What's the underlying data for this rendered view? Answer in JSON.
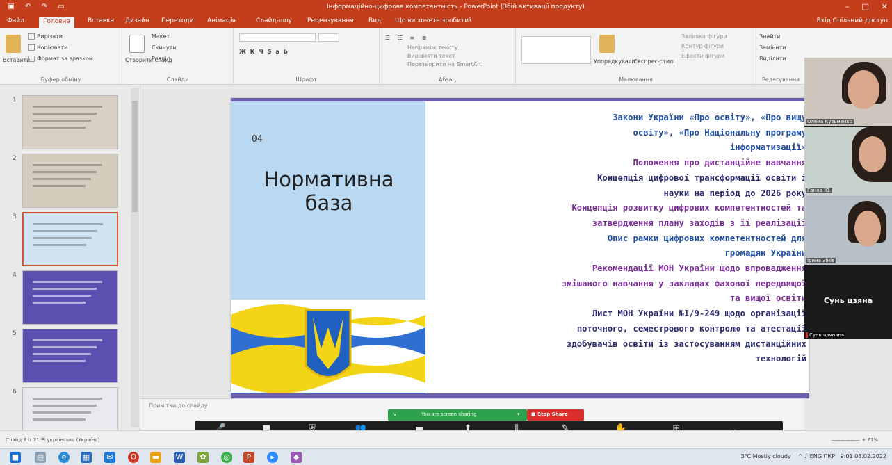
{
  "window": {
    "title": "Інформаційно-цифрова компетентність - PowerPoint (Збій активації продукту)",
    "controls": [
      "–",
      "□",
      "✕"
    ]
  },
  "tabs": [
    "Файл",
    "Головна",
    "Вставка",
    "Дизайн",
    "Переходи",
    "Анімація",
    "Слайд-шоу",
    "Рецензування",
    "Вид",
    "Що ви хочете зробити?"
  ],
  "active_tab_index": 1,
  "share_label": "Вхід  Спільний доступ",
  "ribbon": {
    "groups": [
      "Буфер обміну",
      "Слайди",
      "Шрифт",
      "Абзац",
      "Малювання",
      "Редагування"
    ],
    "clipboard": {
      "paste": "Вставити",
      "cut": "Вирізати",
      "copy": "Копіювати",
      "format": "Формат за зразком"
    },
    "slides": {
      "new_slide": "Створити слайд",
      "layout": "Макет",
      "reset": "Скинути",
      "section": "Розділ"
    },
    "paragraph": {
      "direction": "Напрямок тексту",
      "align": "Вирівняти текст",
      "smartart": "Перетворити на SmartArt"
    },
    "drawing": {
      "arrange": "Упорядкувати",
      "quick_styles": "Експрес-стилі",
      "fill": "Заливка фігури",
      "outline": "Контур фігури",
      "effects": "Ефекти фігури"
    },
    "editing": {
      "find": "Знайти",
      "replace": "Замінити",
      "select": "Виділити"
    }
  },
  "thumbnails": [
    {
      "num": "1",
      "bg": "#d9cfc2",
      "selected": false
    },
    {
      "num": "2",
      "bg": "#d6ccbd",
      "selected": false
    },
    {
      "num": "3",
      "bg": "#cfe3f3",
      "selected": true
    },
    {
      "num": "4",
      "bg": "#5b4fb0",
      "selected": false
    },
    {
      "num": "5",
      "bg": "#5b4fb0",
      "selected": false
    },
    {
      "num": "6",
      "bg": "#e9e9ef",
      "selected": false
    }
  ],
  "slide": {
    "number": "04",
    "heading_line1": "Нормативна",
    "heading_line2": "база",
    "lines": [
      {
        "text": "Закони України «Про освіту», «Про вищу",
        "color": "c-blue"
      },
      {
        "text": "освіту», «Про Національну програму",
        "color": "c-blue"
      },
      {
        "text": "інформатизації»",
        "color": "c-blue"
      },
      {
        "text": "Положення про дистанційне навчання",
        "color": "c-purple"
      },
      {
        "text": "Концепція цифрової трансформації освіти і",
        "color": "c-dark"
      },
      {
        "text": "науки на період до 2026 року",
        "color": "c-dark"
      },
      {
        "text": "Концепція розвитку цифрових компетентностей та",
        "color": "c-purple"
      },
      {
        "text": "затвердження плану заходів з її реалізації",
        "color": "c-purple"
      },
      {
        "text": "Опис рамки цифрових компетентностей для",
        "color": "c-blue"
      },
      {
        "text": "громадян України",
        "color": "c-blue"
      },
      {
        "text": "Рекомендації МОН України щодо впровадження",
        "color": "c-purple"
      },
      {
        "text": "змішаного навчання у закладах фахової передвищої",
        "color": "c-purple"
      },
      {
        "text": "та вищої освіти",
        "color": "c-purple"
      },
      {
        "text": "Лист МОН України №1/9-249 щодо організації",
        "color": "c-dark"
      },
      {
        "text": "поточного, семестрового контролю та атестації",
        "color": "c-dark"
      },
      {
        "text": "здобувачів освіти із застосуванням дистанційних",
        "color": "c-dark"
      },
      {
        "text": "технологій",
        "color": "c-dark"
      }
    ]
  },
  "notes_placeholder": "Примітки до слайду",
  "video": {
    "tiles": [
      {
        "name": "Олена Кузьменко"
      },
      {
        "name": "Ганна Ю."
      },
      {
        "name": "Ірина Зінів"
      }
    ],
    "speaker_big_name": "Сунь цзяна",
    "speaker_small_name": "Сунь цзянань"
  },
  "zoom": {
    "share_status": "You are screen sharing",
    "stop_share": "■ Stop Share",
    "buttons": [
      {
        "icon": "🎤",
        "label": "Mute"
      },
      {
        "icon": "■",
        "label": "Stop Video"
      },
      {
        "icon": "⛨",
        "label": "Security"
      },
      {
        "icon": "👥",
        "label": "Participants"
      },
      {
        "icon": "▬",
        "label": "Chat"
      },
      {
        "icon": "⬆",
        "label": "New Share"
      },
      {
        "icon": "‖",
        "label": "Pause Share"
      },
      {
        "icon": "✎",
        "label": "Annotate"
      },
      {
        "icon": "✋",
        "label": "Remote Control"
      },
      {
        "icon": "⊞",
        "label": "Apps"
      },
      {
        "icon": "…",
        "label": "More"
      }
    ]
  },
  "statusbar": {
    "left": "Слайд 3 із 21   ☰  українська (Україна)",
    "zoom": "—————— + 71%"
  },
  "taskbar": {
    "weather": "3°C  Mostly cloudy",
    "tray": "^  ♪  ENG  ПКР",
    "time": "9:01",
    "date": "08.02.2022"
  }
}
